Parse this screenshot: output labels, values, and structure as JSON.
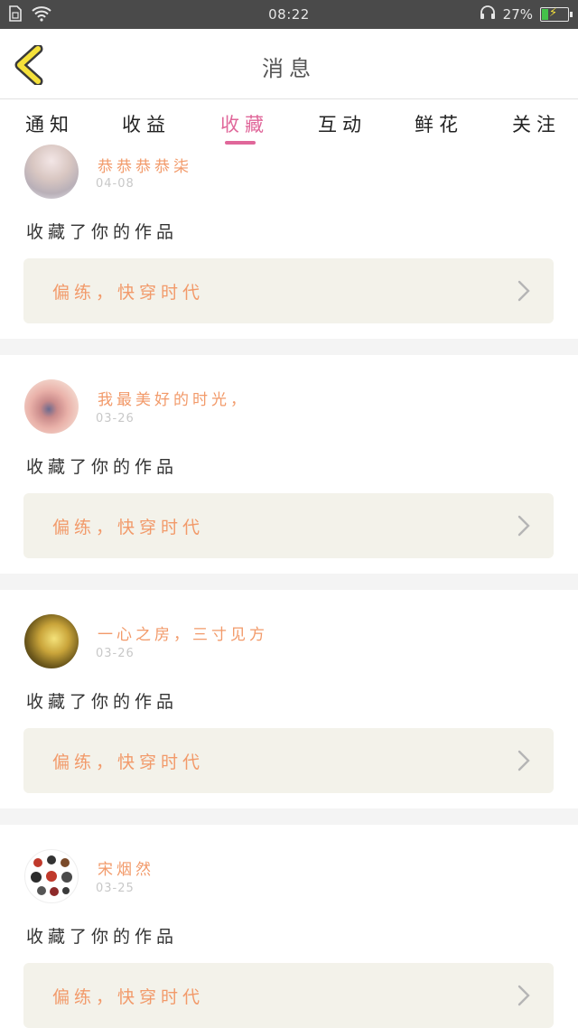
{
  "status_bar": {
    "time": "08:22",
    "battery_percent": "27%",
    "battery_level": 0.27
  },
  "header": {
    "title": "消息"
  },
  "tabs": [
    {
      "label": "通知",
      "active": false
    },
    {
      "label": "收益",
      "active": false
    },
    {
      "label": "收藏",
      "active": true
    },
    {
      "label": "互动",
      "active": false
    },
    {
      "label": "鲜花",
      "active": false
    },
    {
      "label": "关注",
      "active": false
    }
  ],
  "items": [
    {
      "username": "恭恭恭恭柒",
      "date": "04-08",
      "action": "收藏了你的作品",
      "work_title": "偏练，快穿时代"
    },
    {
      "username": "我最美好的时光，",
      "date": "03-26",
      "action": "收藏了你的作品",
      "work_title": "偏练，快穿时代"
    },
    {
      "username": "一心之房，三寸见方",
      "date": "03-26",
      "action": "收藏了你的作品",
      "work_title": "偏练，快穿时代"
    },
    {
      "username": "宋烟然",
      "date": "03-25",
      "action": "收藏了你的作品",
      "work_title": "偏练，快穿时代"
    }
  ],
  "colors": {
    "accent": "#e0679a",
    "username": "#f29a6a",
    "card_bg": "#f3f2ea",
    "back_arrow": "#f5e13a"
  }
}
